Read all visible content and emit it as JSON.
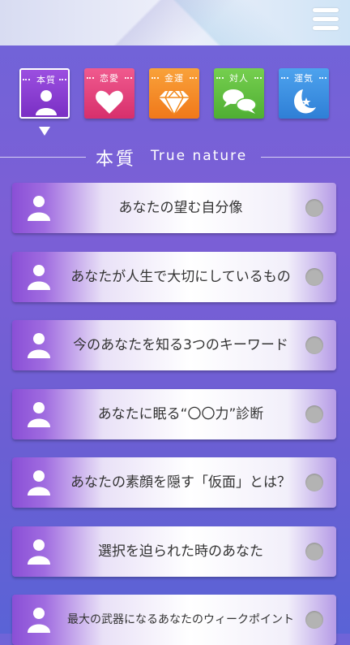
{
  "header": {
    "menu_icon": "hamburger-menu-icon"
  },
  "tabs": [
    {
      "label": "本質",
      "icon": "person-icon",
      "color": "#8a3fd1",
      "active": true
    },
    {
      "label": "恋愛",
      "icon": "heart-icon",
      "color": "#e03a7a",
      "active": false
    },
    {
      "label": "金運",
      "icon": "diamond-icon",
      "color": "#f28a1e",
      "active": false
    },
    {
      "label": "対人",
      "icon": "speech-bubbles-icon",
      "color": "#5dbf3f",
      "active": false
    },
    {
      "label": "運気",
      "icon": "moon-star-icon",
      "color": "#3b8fe0",
      "active": false
    }
  ],
  "section": {
    "title_jp": "本質",
    "title_en": "True nature"
  },
  "items": [
    {
      "label": "あなたの望む自分像"
    },
    {
      "label": "あなたが人生で大切にしているもの"
    },
    {
      "label": "今のあなたを知る3つのキーワード"
    },
    {
      "label": "あなたに眠る“〇〇力”診断"
    },
    {
      "label": "あなたの素顔を隠す「仮面」とは？"
    },
    {
      "label": "選択を迫られた時のあなた"
    },
    {
      "label": "最大の武器になるあなたのウィークポイント"
    }
  ]
}
